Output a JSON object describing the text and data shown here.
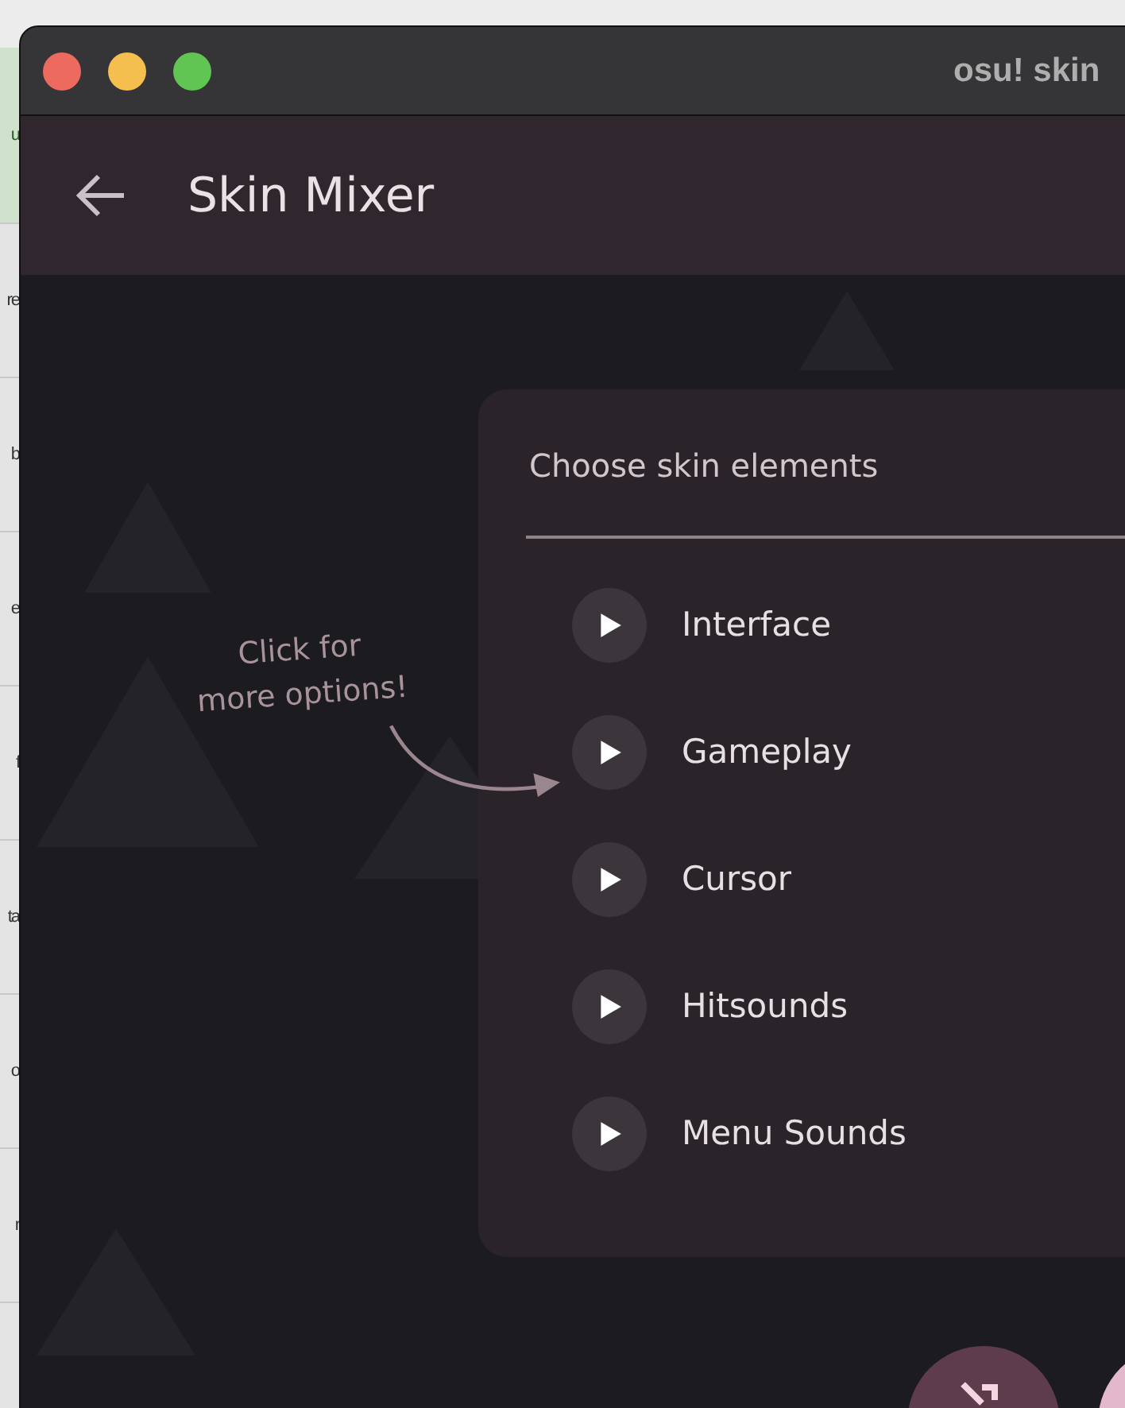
{
  "background_window": {
    "row_texts": [
      "u",
      "re",
      "b",
      "e",
      "f",
      "ta",
      "o",
      "r"
    ]
  },
  "window": {
    "title": "osu! skin"
  },
  "header": {
    "title": "Skin Mixer"
  },
  "hint": {
    "lines": [
      "Click for",
      "more options!"
    ]
  },
  "panel": {
    "title": "Choose skin elements",
    "items": [
      {
        "label": "Interface",
        "expanded": false
      },
      {
        "label": "Gameplay",
        "expanded": false
      },
      {
        "label": "Cursor",
        "expanded": false
      },
      {
        "label": "Hitsounds",
        "expanded": false
      },
      {
        "label": "Menu Sounds",
        "expanded": false
      }
    ]
  },
  "bottom_buttons": [
    {
      "kind": "shuffle",
      "color": "#5e3c4b"
    },
    {
      "kind": "plain",
      "color": "#e4b8cc"
    }
  ]
}
